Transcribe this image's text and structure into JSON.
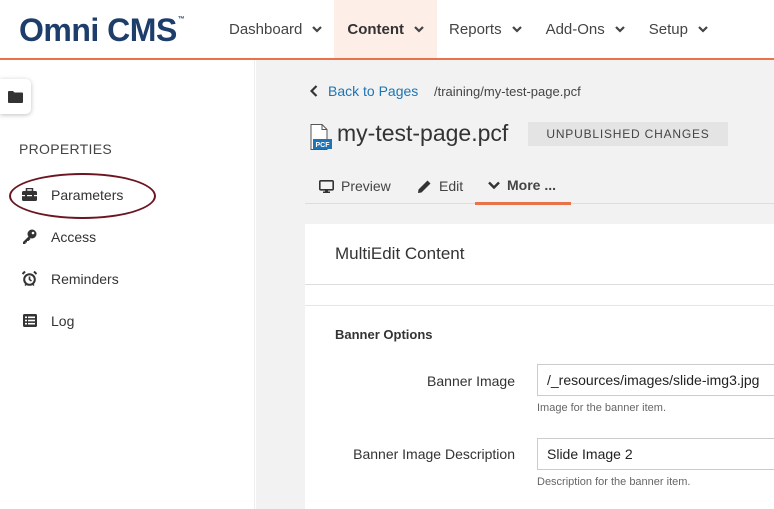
{
  "app": {
    "logo_text": "Omni CMS",
    "logo_tm": "™"
  },
  "nav": {
    "items": [
      {
        "label": "Dashboard",
        "active": false
      },
      {
        "label": "Content",
        "active": true
      },
      {
        "label": "Reports",
        "active": false
      },
      {
        "label": "Add-Ons",
        "active": false
      },
      {
        "label": "Setup",
        "active": false
      }
    ]
  },
  "sidebar": {
    "folder_icon": "folder-icon",
    "section_title": "PROPERTIES",
    "items": [
      {
        "label": "Parameters",
        "icon": "toolbox-icon"
      },
      {
        "label": "Access",
        "icon": "key-icon"
      },
      {
        "label": "Reminders",
        "icon": "alarm-clock-icon"
      },
      {
        "label": "Log",
        "icon": "list-icon"
      }
    ]
  },
  "breadcrumb": {
    "back_label": "Back to Pages",
    "path": "/training/my-test-page.pcf"
  },
  "page": {
    "title": "my-test-page.pcf",
    "file_icon_label": "PCF",
    "badge": "UNPUBLISHED CHANGES"
  },
  "tabs": [
    {
      "label": "Preview",
      "icon": "monitor-icon"
    },
    {
      "label": "Edit",
      "icon": "pencil-icon"
    },
    {
      "label": "More ...",
      "icon": "chevron-down-icon",
      "active": true
    }
  ],
  "card": {
    "title": "MultiEdit Content",
    "section_title": "Banner Options",
    "fields": [
      {
        "label": "Banner Image",
        "value": "/_resources/images/slide-img3.jpg",
        "help": "Image for the banner item."
      },
      {
        "label": "Banner Image Description",
        "value": "Slide Image 2",
        "help": "Description for the banner item."
      }
    ]
  },
  "colors": {
    "accent": "#e8724a",
    "brand": "#1d3d6b",
    "link": "#1f74b3",
    "annotation_circle": "#6b1520"
  }
}
